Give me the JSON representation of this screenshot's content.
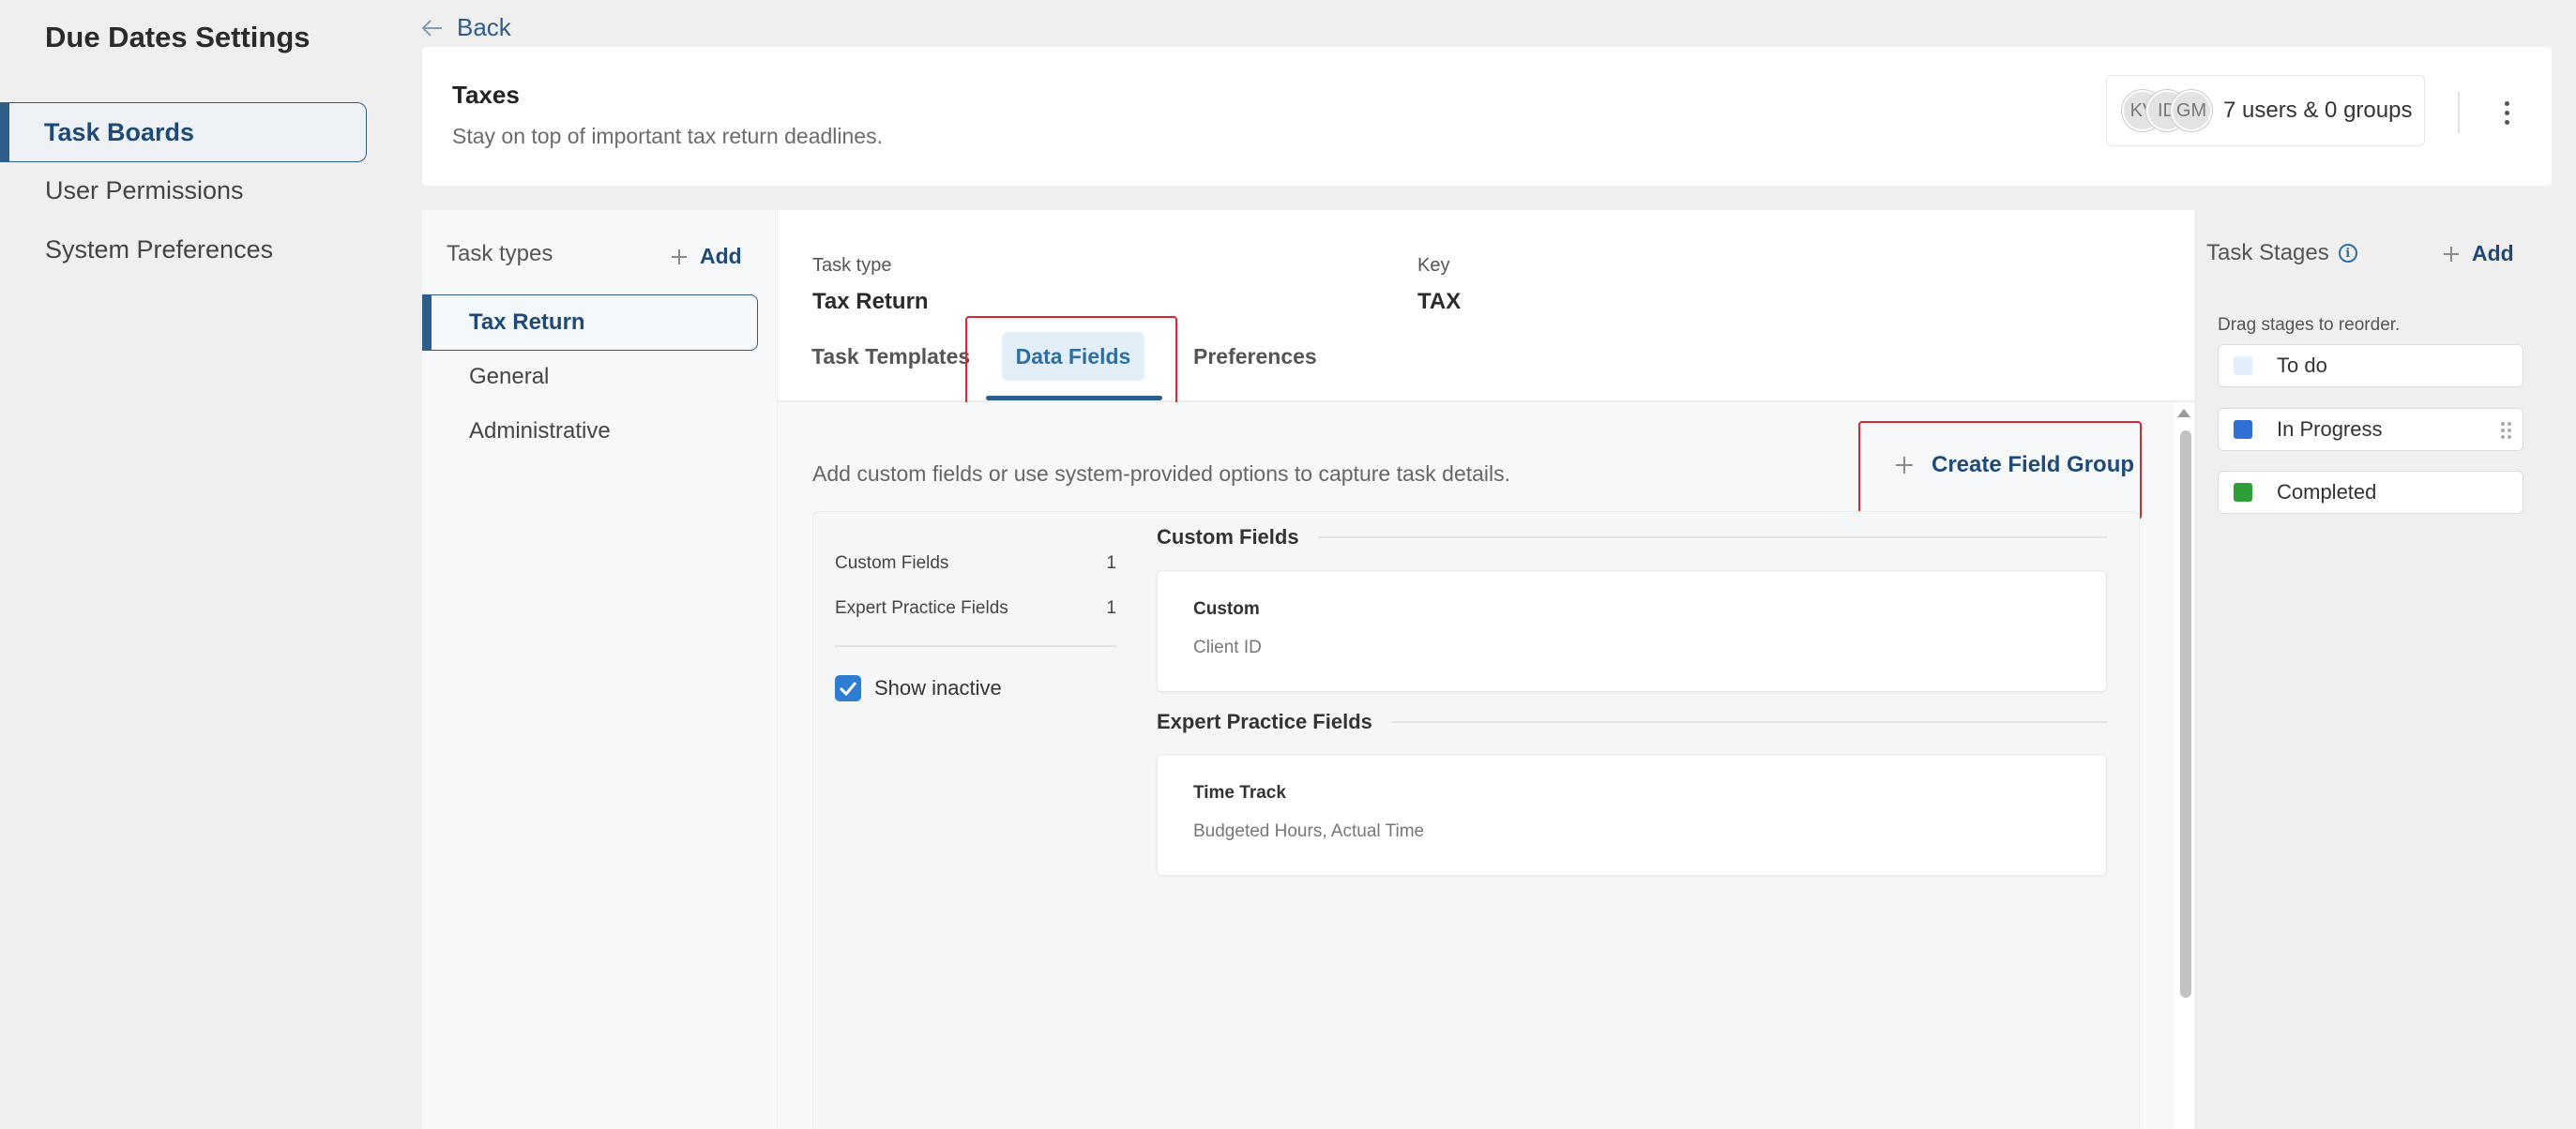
{
  "sidebar": {
    "title": "Due Dates Settings",
    "items": [
      {
        "label": "Task Boards"
      },
      {
        "label": "User Permissions"
      },
      {
        "label": "System Preferences"
      }
    ]
  },
  "back_label": "Back",
  "header": {
    "title": "Taxes",
    "description": "Stay on top of important tax return deadlines.",
    "avatars": [
      "KV",
      "ID",
      "GM"
    ],
    "members_summary": "7 users & 0 groups"
  },
  "task_types": {
    "label": "Task types",
    "add_label": "Add",
    "items": [
      {
        "label": "Tax Return"
      },
      {
        "label": "General"
      },
      {
        "label": "Administrative"
      }
    ]
  },
  "details": {
    "task_type_label": "Task type",
    "task_type_value": "Tax Return",
    "key_label": "Key",
    "key_value": "TAX",
    "tabs": [
      {
        "label": "Task Templates"
      },
      {
        "label": "Data Fields"
      },
      {
        "label": "Preferences"
      }
    ],
    "intro": "Add custom fields or use system-provided options to capture task details.",
    "create_label": "Create Field Group",
    "counts": [
      {
        "label": "Custom Fields",
        "count": "1"
      },
      {
        "label": "Expert Practice Fields",
        "count": "1"
      }
    ],
    "show_inactive_label": "Show inactive",
    "show_inactive_checked": true,
    "sections": [
      {
        "heading": "Custom Fields",
        "card_title": "Custom",
        "card_sub": "Client ID"
      },
      {
        "heading": "Expert Practice Fields",
        "card_title": "Time Track",
        "card_sub": "Budgeted Hours, Actual Time"
      }
    ]
  },
  "stages": {
    "label": "Task Stages",
    "add_label": "Add",
    "hint": "Drag stages to reorder.",
    "items": [
      {
        "label": "To do",
        "color": "#e3eefb"
      },
      {
        "label": "In Progress",
        "color": "#2f6fd6"
      },
      {
        "label": "Completed",
        "color": "#2e9e36"
      }
    ]
  },
  "colors": {
    "accent": "#2f5d8a",
    "highlight": "#e0252d"
  }
}
